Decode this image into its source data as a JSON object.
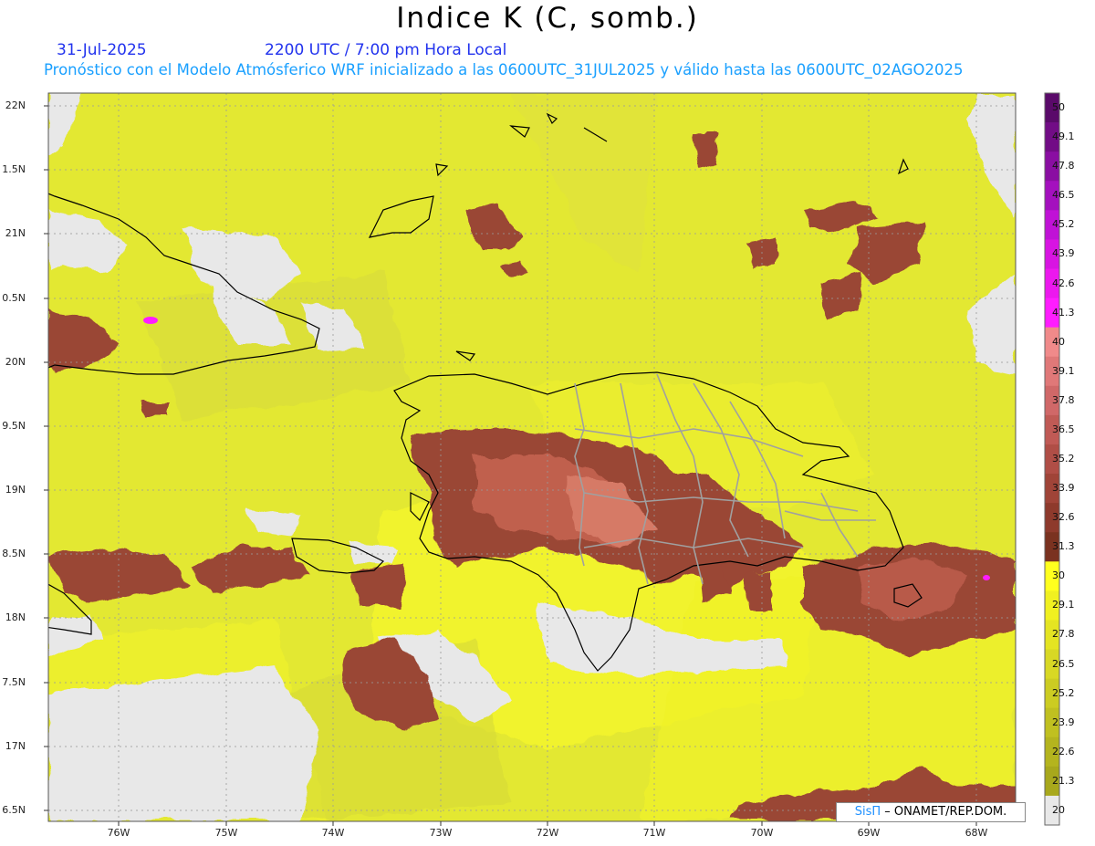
{
  "title": "Indice K (C, somb.)",
  "header": {
    "date": "31-Jul-2025",
    "time": "2200 UTC / 7:00 pm Hora Local",
    "subtitle": "Pronóstico con el Modelo Atmósferico WRF inicializado a las 0600UTC_31JUL2025 y válido hasta las  0600UTC_02AGO2025"
  },
  "credit": {
    "brand": "SisΠ",
    "rest": "– ONAMET/REP.DOM."
  },
  "lat_labels": [
    "22N",
    "1.5N",
    "21N",
    "0.5N",
    "20N",
    "9.5N",
    "19N",
    "8.5N",
    "18N",
    "7.5N",
    "17N",
    "6.5N"
  ],
  "lon_labels": [
    "76W",
    "75W",
    "74W",
    "73W",
    "72W",
    "71W",
    "70W",
    "69W",
    "68W"
  ],
  "colorbar": {
    "labels": [
      "50",
      "49.1",
      "47.8",
      "46.5",
      "45.2",
      "43.9",
      "42.6",
      "41.3",
      "40",
      "39.1",
      "37.8",
      "36.5",
      "35.2",
      "33.9",
      "32.6",
      "31.3",
      "30",
      "29.1",
      "27.8",
      "26.5",
      "25.2",
      "23.9",
      "22.6",
      "21.3",
      "20"
    ],
    "colors": [
      "#5a0a6a",
      "#720c86",
      "#8a0ea2",
      "#a410be",
      "#c012d6",
      "#d814e2",
      "#ec18ee",
      "#ff1cff",
      "#f08a8a",
      "#e07878",
      "#d06868",
      "#c05a55",
      "#b04e46",
      "#a04438",
      "#8e3a2c",
      "#7a3220",
      "#ffff1e",
      "#f0f020",
      "#e4e422",
      "#d8d824",
      "#cccc22",
      "#c0c020",
      "#b4b41e",
      "#a8a81c",
      "#e8e8e8"
    ]
  },
  "legend_colors": {
    "land_gray": "#e8e8e8",
    "yellow_main": "#e3e832",
    "yellow_bright": "#f4f52a",
    "brown_dark": "#8a3a2e",
    "brown_mid": "#a84e40",
    "salmon": "#d67a66",
    "magenta": "#ff1cff",
    "border": "#a0a0a0"
  }
}
